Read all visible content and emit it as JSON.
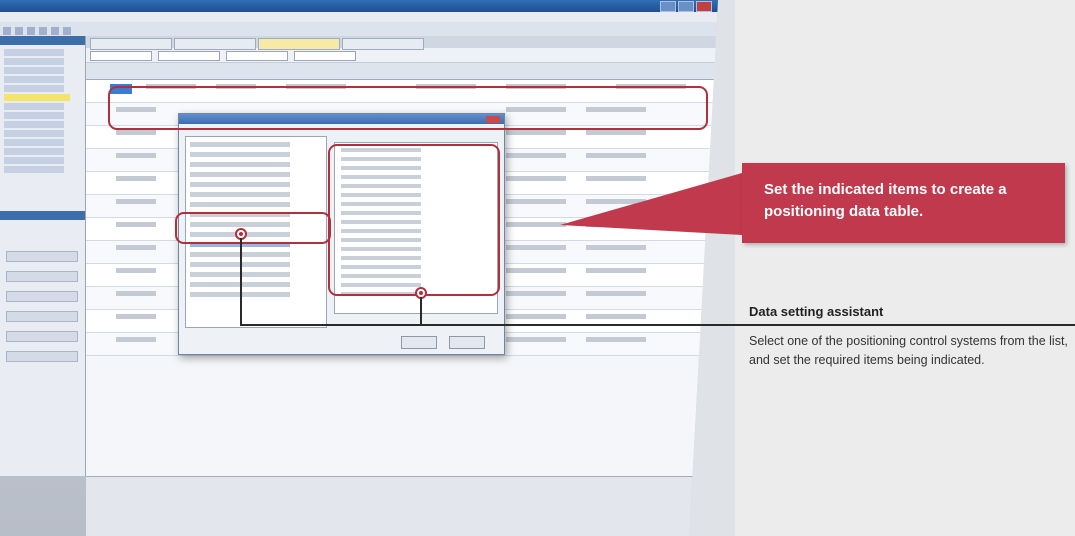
{
  "callout": {
    "text": "Set the indicated items to create a positioning data table."
  },
  "assistant": {
    "title": "Data setting assistant",
    "description": "Select one of the positioning control systems from the list, and set the required items being indicated."
  },
  "colors": {
    "accent_red": "#c0394d",
    "outline_red": "#b0303c",
    "window_blue": "#2f6fb8",
    "background": "#ececec"
  }
}
